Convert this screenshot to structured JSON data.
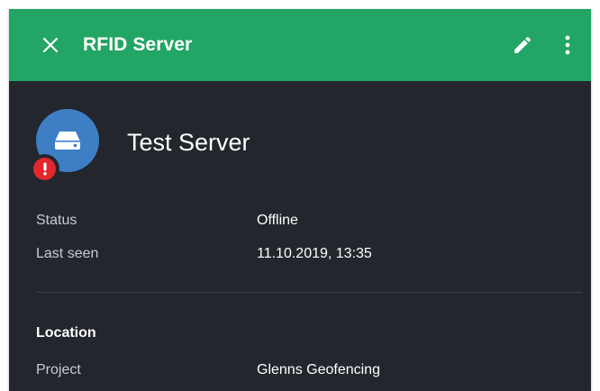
{
  "appbar": {
    "title": "RFID Server",
    "accent_color": "#23a565",
    "close_icon": "close-icon",
    "edit_icon": "pencil-icon",
    "menu_icon": "more-vertical-icon"
  },
  "device": {
    "name": "Test Server",
    "avatar_icon": "storage-icon",
    "avatar_color": "#3e7ec5",
    "alert_icon": "exclamation-icon",
    "alert_color": "#e3262d"
  },
  "details": {
    "status_label": "Status",
    "status_value": "Offline",
    "last_seen_label": "Last seen",
    "last_seen_value": "11.10.2019, 13:35"
  },
  "location": {
    "heading": "Location",
    "project_label": "Project",
    "project_value": "Glenns Geofencing"
  }
}
